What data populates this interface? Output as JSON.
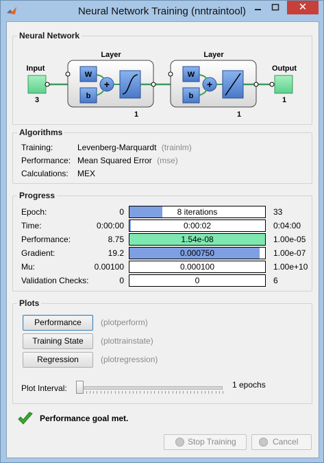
{
  "window": {
    "title": "Neural Network Training (nntraintool)",
    "close_glyph": "✕"
  },
  "network_panel": {
    "title": "Neural Network",
    "input": {
      "label": "Input",
      "size": "3"
    },
    "hidden_layer": {
      "label": "Layer",
      "size": "1",
      "w": "W",
      "b": "b",
      "plus": "+"
    },
    "output_layer": {
      "label": "Layer",
      "size": "1",
      "w": "W",
      "b": "b",
      "plus": "+"
    },
    "output": {
      "label": "Output",
      "size": "1"
    }
  },
  "algorithms": {
    "title": "Algorithms",
    "rows": [
      {
        "label": "Training:",
        "value": "Levenberg-Marquardt",
        "hint": "(trainlm)"
      },
      {
        "label": "Performance:",
        "value": "Mean Squared Error",
        "hint": "(mse)"
      },
      {
        "label": "Calculations:",
        "value": "MEX",
        "hint": ""
      }
    ]
  },
  "progress": {
    "title": "Progress",
    "rows": [
      {
        "label": "Epoch:",
        "start": "0",
        "value": "8 iterations",
        "end": "33",
        "fill": 0.24,
        "color": "#7f9fe3"
      },
      {
        "label": "Time:",
        "start": "0:00:00",
        "value": "0:00:02",
        "end": "0:04:00",
        "fill": 0.01,
        "color": "#7f9fe3"
      },
      {
        "label": "Performance:",
        "start": "8.75",
        "value": "1.54e-08",
        "end": "1.00e-05",
        "fill": 1.0,
        "color": "#7ee8b0"
      },
      {
        "label": "Gradient:",
        "start": "19.2",
        "value": "0.000750",
        "end": "1.00e-07",
        "fill": 0.96,
        "color": "#7f9fe3"
      },
      {
        "label": "Mu:",
        "start": "0.00100",
        "value": "0.000100",
        "end": "1.00e+10",
        "fill": 0.0,
        "color": "#7f9fe3"
      },
      {
        "label": "Validation Checks:",
        "start": "0",
        "value": "0",
        "end": "6",
        "fill": 0.0,
        "color": "#7f9fe3"
      }
    ]
  },
  "plots": {
    "title": "Plots",
    "buttons": [
      {
        "label": "Performance",
        "hint": "(plotperform)"
      },
      {
        "label": "Training State",
        "hint": "(plottrainstate)"
      },
      {
        "label": "Regression",
        "hint": "(plotregression)"
      }
    ],
    "interval_label": "Plot Interval:",
    "interval_value": "1 epochs",
    "interval_fraction": 0.0
  },
  "status": {
    "text": "Performance goal met."
  },
  "footer": {
    "stop_label": "Stop Training",
    "cancel_label": "Cancel"
  }
}
